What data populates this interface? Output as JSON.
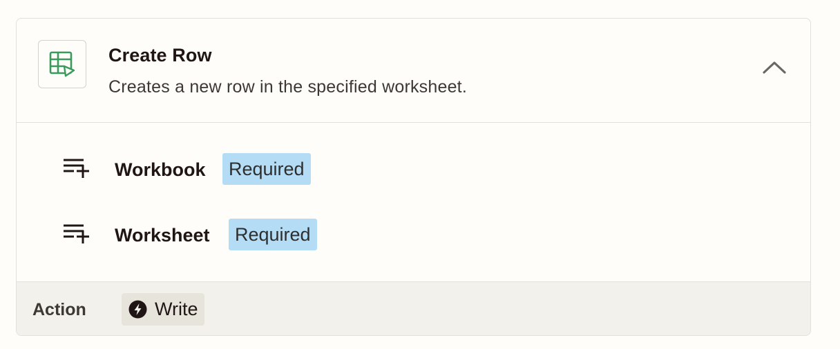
{
  "step": {
    "title": "Create Row",
    "description": "Creates a new row in the specified worksheet."
  },
  "fields": [
    {
      "label": "Workbook",
      "badge": "Required"
    },
    {
      "label": "Worksheet",
      "badge": "Required"
    }
  ],
  "footer": {
    "label": "Action",
    "type": "Write"
  },
  "colors": {
    "app_icon_green": "#3a9a5c",
    "required_badge_bg": "#b5dcf5",
    "footer_bg": "#f3f1eb"
  },
  "icons": {
    "app": "spreadsheet-icon",
    "collapse": "chevron-up-icon",
    "field": "add-to-list-icon",
    "type": "lightning-bolt-icon"
  }
}
